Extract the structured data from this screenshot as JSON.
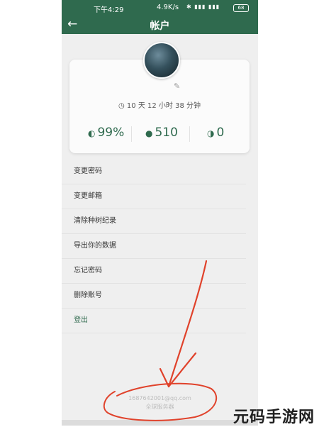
{
  "status_bar": {
    "time": "下午4:29",
    "network_speed": "4.9K/s",
    "signal_icons": "✱ ▮▮▮ ▮▮▮",
    "battery": "68"
  },
  "app_bar": {
    "title": "帐户",
    "back_icon": "←"
  },
  "profile": {
    "edit_icon": "✎",
    "time_icon": "◷",
    "time_text": "10 天 12 小时 38 分钟",
    "stats": [
      {
        "icon": "◐",
        "value": "99%"
      },
      {
        "icon": "●",
        "value": "510"
      },
      {
        "icon": "◑",
        "value": "0"
      }
    ]
  },
  "menu": [
    {
      "label": "变更密码"
    },
    {
      "label": "变更邮箱"
    },
    {
      "label": "清除种树纪录"
    },
    {
      "label": "导出你的数据"
    },
    {
      "label": "忘记密码"
    },
    {
      "label": "删除账号"
    },
    {
      "label": "登出"
    }
  ],
  "footer": {
    "email": "1687642001@qq.com",
    "server": "全球服务器"
  },
  "watermark": "元码手游网",
  "colors": {
    "accent": "#2f6a4e",
    "annotation": "#e0422b"
  }
}
